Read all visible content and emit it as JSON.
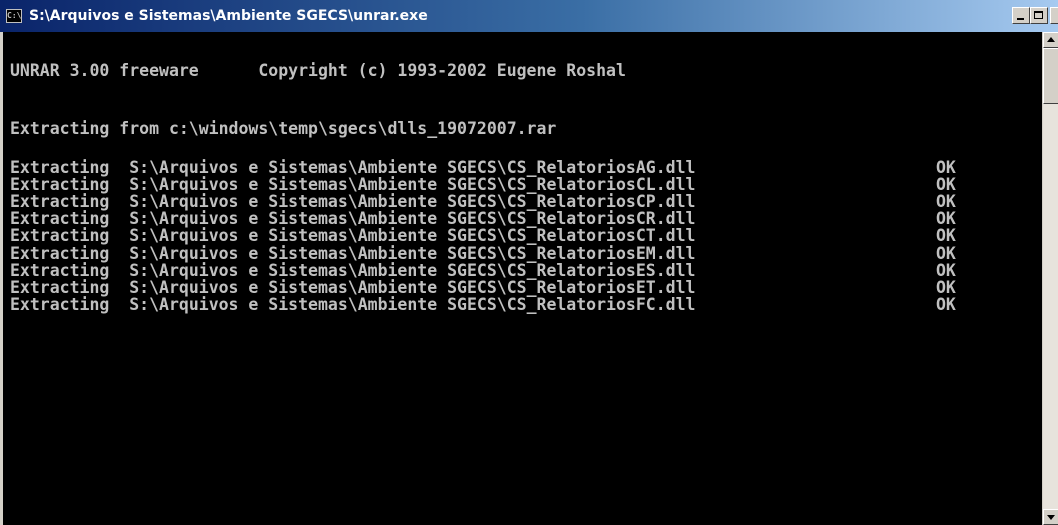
{
  "window": {
    "title": "S:\\Arquivos e Sistemas\\Ambiente SGECS\\unrar.exe",
    "icon": "console-icon",
    "icon_text": "C:\\"
  },
  "console": {
    "header": "UNRAR 3.00 freeware      Copyright (c) 1993-2002 Eugene Roshal",
    "archive_line": "Extracting from c:\\windows\\temp\\sgecs\\dlls_19072007.rar",
    "rows": [
      {
        "action": "Extracting",
        "path": "S:\\Arquivos e Sistemas\\Ambiente SGECS\\CS_RelatoriosAG.dll",
        "status": "OK"
      },
      {
        "action": "Extracting",
        "path": "S:\\Arquivos e Sistemas\\Ambiente SGECS\\CS_RelatoriosCL.dll",
        "status": "OK"
      },
      {
        "action": "Extracting",
        "path": "S:\\Arquivos e Sistemas\\Ambiente SGECS\\CS_RelatoriosCP.dll",
        "status": "OK"
      },
      {
        "action": "Extracting",
        "path": "S:\\Arquivos e Sistemas\\Ambiente SGECS\\CS_RelatoriosCR.dll",
        "status": "OK"
      },
      {
        "action": "Extracting",
        "path": "S:\\Arquivos e Sistemas\\Ambiente SGECS\\CS_RelatoriosCT.dll",
        "status": "OK"
      },
      {
        "action": "Extracting",
        "path": "S:\\Arquivos e Sistemas\\Ambiente SGECS\\CS_RelatoriosEM.dll",
        "status": "OK"
      },
      {
        "action": "Extracting",
        "path": "S:\\Arquivos e Sistemas\\Ambiente SGECS\\CS_RelatoriosES.dll",
        "status": "OK"
      },
      {
        "action": "Extracting",
        "path": "S:\\Arquivos e Sistemas\\Ambiente SGECS\\CS_RelatoriosET.dll",
        "status": "OK"
      },
      {
        "action": "Extracting",
        "path": "S:\\Arquivos e Sistemas\\Ambiente SGECS\\CS_RelatoriosFC.dll",
        "status": "OK"
      }
    ]
  },
  "colors": {
    "title_active_start": "#0a246a",
    "title_active_end": "#a6caf0",
    "console_bg": "#000000",
    "console_fg": "#c0c0c0"
  }
}
